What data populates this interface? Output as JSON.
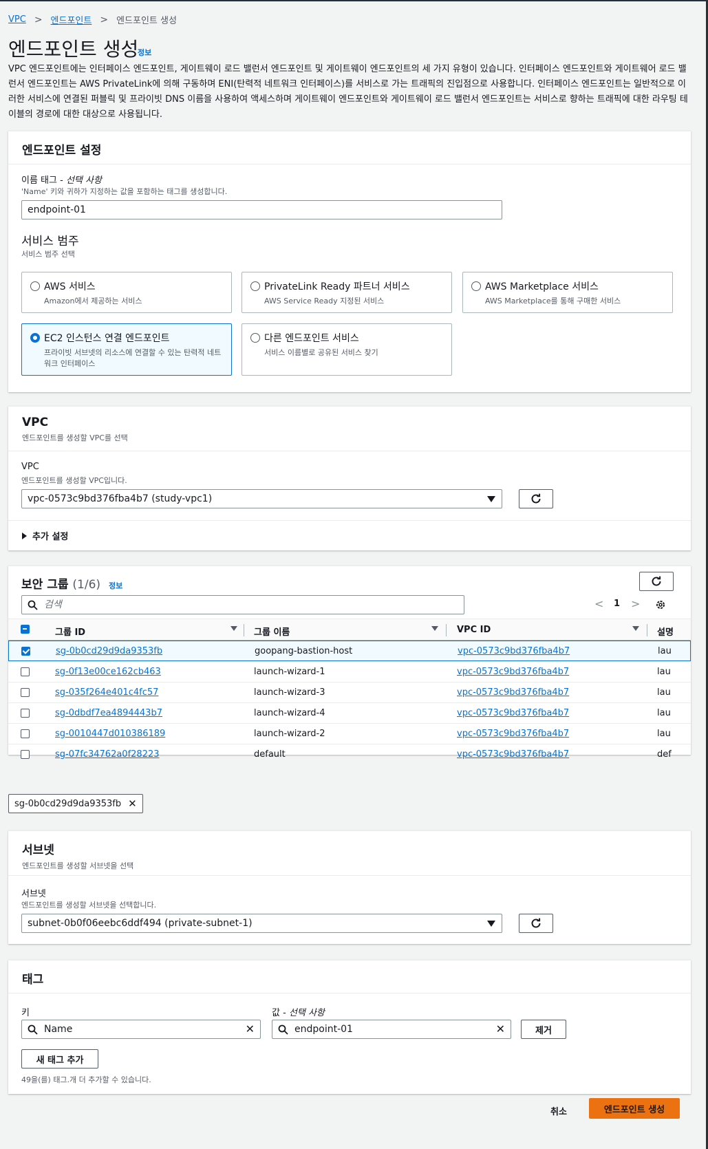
{
  "breadcrumb": {
    "vpc": "VPC",
    "endpoints": "엔드포인트",
    "current": "엔드포인트 생성"
  },
  "header": {
    "title": "엔드포인트 생성",
    "info": "정보",
    "description": "VPC 엔드포인트에는 인터페이스 엔드포인트, 게이트웨이 로드 밸런서 엔드포인트 및 게이트웨이 엔드포인트의 세 가지 유형이 있습니다. 인터페이스 엔드포인트와 게이트웨어 로드 밸런서 엔드포인트는 AWS PrivateLink에 의해 구동하며 ENI(탄력적 네트워크 인터페이스)를 서비스로 가는 트래픽의 진입점으로 사용합니다. 인터페이스 엔드포인트는 일반적으로 이러한 서비스에 연결된 퍼블릭 및 프라이빗 DNS 이름을 사용하여 액세스하며 게이트웨이 엔드포인트와 게이트웨이 로드 밸런서 엔드포인트는 서비스로 향하는 트래픽에 대한 라우팅 테이블의 경로에 대한 대상으로 사용됩니다."
  },
  "settings": {
    "title": "엔드포인트 설정",
    "name_label": "이름 태그 - ",
    "name_optional": "선택 사항",
    "name_hint": "'Name' 키와 귀하가 지정하는 값을 포함하는 태그를 생성합니다.",
    "name_value": "endpoint-01",
    "category_title": "서비스 범주",
    "category_hint": "서비스 범주 선택",
    "options": [
      {
        "title": "AWS 서비스",
        "desc": "Amazon에서 제공하는 서비스",
        "selected": false
      },
      {
        "title": "PrivateLink Ready 파트너 서비스",
        "desc": "AWS Service Ready 지정된 서비스",
        "selected": false
      },
      {
        "title": "AWS Marketplace 서비스",
        "desc": "AWS Marketplace를 통해 구매한 서비스",
        "selected": false
      },
      {
        "title": "EC2 인스턴스 연결 엔드포인트",
        "desc": "프라이빗 서브넷의 리소스에 연결할 수 있는 탄력적 네트워크 인터페이스",
        "selected": true
      },
      {
        "title": "다른 엔드포인트 서비스",
        "desc": "서비스 이름별로 공유된 서비스 찾기",
        "selected": false
      }
    ]
  },
  "vpc": {
    "title": "VPC",
    "subtitle": "엔드포인트를 생성할 VPC를 선택",
    "label": "VPC",
    "hint": "엔드포인트를 생성할 VPC입니다.",
    "value": "vpc-0573c9bd376fba4b7 (study-vpc1)",
    "additional": "추가 설정"
  },
  "sg": {
    "title": "보안 그룹",
    "count": "(1/6)",
    "info": "정보",
    "search_placeholder": "검색",
    "page": "1",
    "columns": {
      "id": "그룹 ID",
      "name": "그룹 이름",
      "vpc": "VPC ID",
      "desc": "설명"
    },
    "rows": [
      {
        "id": "sg-0b0cd29d9da9353fb",
        "name": "goopang-bastion-host",
        "vpc": "vpc-0573c9bd376fba4b7",
        "desc": "lau",
        "checked": true
      },
      {
        "id": "sg-0f13e00ce162cb463",
        "name": "launch-wizard-1",
        "vpc": "vpc-0573c9bd376fba4b7",
        "desc": "lau",
        "checked": false
      },
      {
        "id": "sg-035f264e401c4fc57",
        "name": "launch-wizard-3",
        "vpc": "vpc-0573c9bd376fba4b7",
        "desc": "lau",
        "checked": false
      },
      {
        "id": "sg-0dbdf7ea4894443b7",
        "name": "launch-wizard-4",
        "vpc": "vpc-0573c9bd376fba4b7",
        "desc": "lau",
        "checked": false
      },
      {
        "id": "sg-0010447d010386189",
        "name": "launch-wizard-2",
        "vpc": "vpc-0573c9bd376fba4b7",
        "desc": "lau",
        "checked": false
      },
      {
        "id": "sg-07fc34762a0f28223",
        "name": "default",
        "vpc": "vpc-0573c9bd376fba4b7",
        "desc": "def",
        "checked": false
      }
    ],
    "token": "sg-0b0cd29d9da9353fb"
  },
  "subnet": {
    "title": "서브넷",
    "subtitle": "엔드포인트를 생성할 서브넷을 선택",
    "label": "서브넷",
    "hint": "엔드포인트를 생성할 서브넷을 선택합니다.",
    "value": "subnet-0b0f06eebc6ddf494 (private-subnet-1)"
  },
  "tags": {
    "title": "태그",
    "key_label": "키",
    "value_label": "값 - ",
    "value_optional": "선택 사항",
    "key_value": "Name",
    "value_value": "endpoint-01",
    "remove": "제거",
    "add": "새 태그 추가",
    "limit": "49을(를) 태그.개 더 추가할 수 있습니다."
  },
  "footer": {
    "cancel": "취소",
    "create": "엔드포인트 생성"
  },
  "colors": {
    "link": "#0972d3",
    "primary": "#ec7211",
    "bg": "#f2f3f3"
  }
}
